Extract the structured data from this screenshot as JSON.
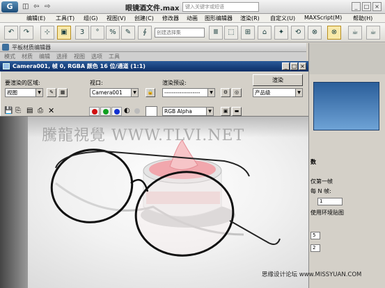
{
  "window": {
    "title": "眼镜酒文件.max",
    "search_placeholder": "键入关键字或短语",
    "minimize": "_",
    "maximize": "□",
    "close": "×"
  },
  "title_tools": [
    "◫",
    "⇦",
    "⇨"
  ],
  "menu": [
    "编辑(E)",
    "工具(T)",
    "组(G)",
    "视图(V)",
    "创建(C)",
    "修改器",
    "动画",
    "图形编辑器",
    "渲染(R)",
    "自定义(U)",
    "MAXScript(M)",
    "帮助(H)"
  ],
  "toolbar": {
    "selection_set_placeholder": "创建选择集",
    "icons": [
      "↶",
      "↷",
      "⊹",
      "⟲",
      "▣",
      "3",
      "°",
      "%",
      "✎",
      "∮",
      "Ⅲ",
      "⬚",
      "⊞",
      "⌂",
      "✦",
      "⊗",
      "☕"
    ]
  },
  "material_editor": {
    "title": "平板材质编辑器",
    "menu": [
      "模式",
      "材质",
      "编辑",
      "选择",
      "视图",
      "选项",
      "工具"
    ]
  },
  "render_window": {
    "title": "Camera001, 帧 0, RGBA 颜色 16 位/通道 (1:1)",
    "area_label": "要渲染的区域:",
    "area_value": "视图",
    "viewport_label": "视口:",
    "viewport_value": "Camera001",
    "preset_label": "渲染预设:",
    "preset_value": "-------------------",
    "render_button": "渲染",
    "quality_value": "产品级",
    "channel_value": "RGB Alpha",
    "channel_colors": [
      "#d01010",
      "#10a020",
      "#1030d0"
    ]
  },
  "render_output": {
    "watermark": "騰龍視覺 WWW.TLVI.NET"
  },
  "command_panel": {
    "rollout_label": "数",
    "first_frame_label": "仅第一帧",
    "nth_frame_label": "每 N 帧:",
    "nth_frame_value": "1",
    "env_map_label": "使用环境贴图",
    "field1": "5",
    "field2": "2"
  },
  "footer": {
    "watermark": "思缘设计论坛 www.MISSYUAN.COM"
  }
}
